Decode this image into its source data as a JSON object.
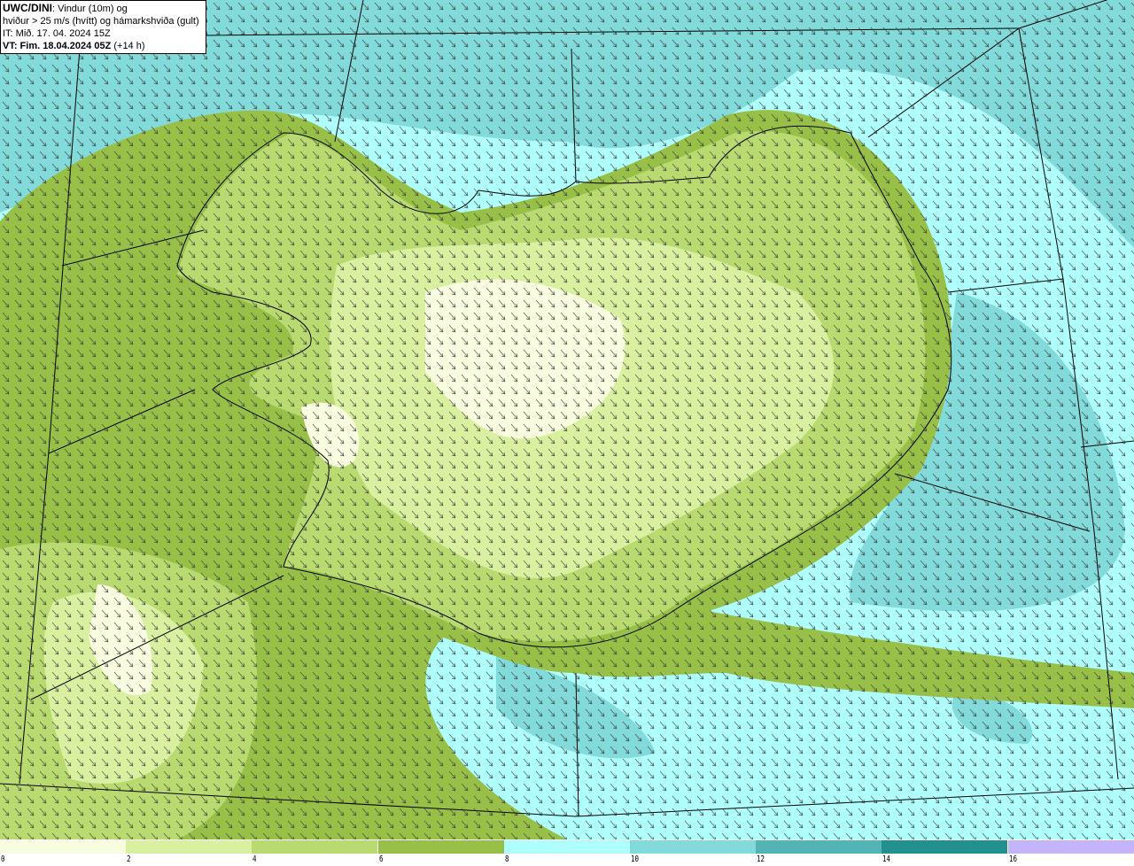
{
  "title": {
    "model": "UWC/DINI",
    "line1_rest": ": Vindur (10m) og",
    "line2": "hviður > 25 m/s (hvítt) og hámarkshviða (gult)",
    "line3": "IT: Mið. 17. 04. 2024 15Z",
    "line4_bold": "VT: Fim. 18.04.2024 05Z",
    "line4_rest": " (+14 h)"
  },
  "map": {
    "region": "Iceland",
    "field": "wind speed 10m",
    "arrow_direction": "from north-west",
    "colors": {
      "sea": "#b0ffff",
      "land_high": "#98c048"
    }
  },
  "legend": {
    "bins": [
      {
        "from": 0,
        "to": 2,
        "color": "#f7fdde"
      },
      {
        "from": 2,
        "to": 4,
        "color": "#d8f0a0"
      },
      {
        "from": 4,
        "to": 6,
        "color": "#b8da70"
      },
      {
        "from": 6,
        "to": 8,
        "color": "#98c048"
      },
      {
        "from": 8,
        "to": 10,
        "color": "#b0ffff"
      },
      {
        "from": 10,
        "to": 12,
        "color": "#82dada"
      },
      {
        "from": 12,
        "to": 14,
        "color": "#52b4b4"
      },
      {
        "from": 14,
        "to": 16,
        "color": "#229090"
      },
      {
        "from": 16,
        "to": null,
        "color": "#c4b4fa"
      }
    ],
    "ticks": [
      "0",
      "2",
      "4",
      "6",
      "8",
      "10",
      "12",
      "14",
      "16"
    ]
  }
}
